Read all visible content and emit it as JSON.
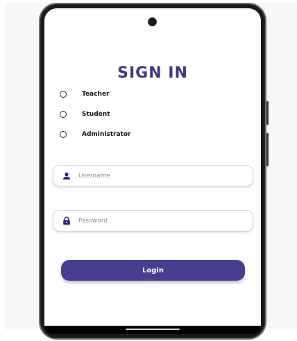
{
  "screen": {
    "title": "SIGN IN",
    "accent_color": "#473e8f",
    "title_color": "#3f3788"
  },
  "role_options": [
    {
      "label": "Teacher",
      "selected": false
    },
    {
      "label": "Student",
      "selected": false
    },
    {
      "label": "Administrator",
      "selected": false
    }
  ],
  "username": {
    "placeholder": "Username",
    "value": "",
    "icon": "person-icon"
  },
  "password": {
    "placeholder": "Password",
    "value": "",
    "icon": "lock-icon"
  },
  "login_button": {
    "label": "Login"
  }
}
